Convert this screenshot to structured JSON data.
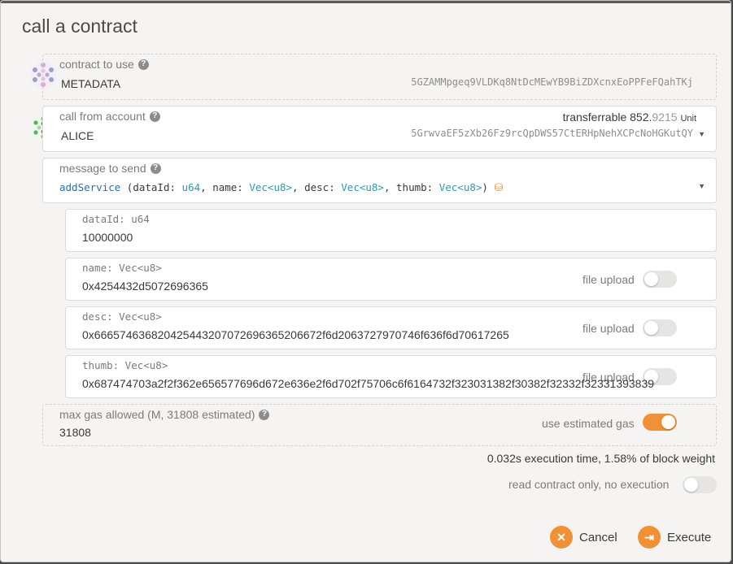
{
  "dialog": {
    "title": "call a contract"
  },
  "contract": {
    "label": "contract to use",
    "name": "METADATA",
    "address": "5GZAMMpgeq9VLDKq8NtDcMEwYB9BiZDXcnxEoPPFeFQahTKj"
  },
  "account": {
    "label": "call from account",
    "name": "ALICE",
    "address": "5GrwvaEF5zXb26Fz9rcQpDWS57CtERHpNehXCPcNoHGKutQY",
    "transferrable_label": "transferrable",
    "balance_int": "852.",
    "balance_dec": "9215",
    "unit": "Unit"
  },
  "message": {
    "label": "message to send",
    "name": "addService",
    "sig_open": " (",
    "params": [
      {
        "name": "dataId",
        "type": "u64"
      },
      {
        "name": "name",
        "type": "Vec<u8>"
      },
      {
        "name": "desc",
        "type": "Vec<u8>"
      },
      {
        "name": "thumb",
        "type": "Vec<u8>"
      }
    ],
    "sig_close": ")"
  },
  "args": [
    {
      "label": "dataId: u64",
      "value": "10000000",
      "has_upload": false
    },
    {
      "label": "name: Vec<u8>",
      "value": "0x4254432d5072696365",
      "has_upload": true,
      "upload_label": "file upload"
    },
    {
      "label": "desc: Vec<u8>",
      "value": "0x666574636820425443207072696365206672f6d2063727970746f636f6d70617265",
      "has_upload": true,
      "upload_label": "file upload"
    },
    {
      "label": "thumb: Vec<u8>",
      "value": "0x687474703a2f2f362e656577696d672e636e2f6d702f75706c6f6164732f323031382f30382f32332f32331393839",
      "has_upload": true,
      "upload_label": "file upload"
    }
  ],
  "gas": {
    "label": "max gas allowed (M, 31808 estimated)",
    "value": "31808",
    "estimated_label": "use estimated gas",
    "estimated_on": true
  },
  "execution_info": "0.032s execution time, 1.58% of block weight",
  "read_only": {
    "label": "read contract only, no execution",
    "on": false
  },
  "buttons": {
    "cancel": "Cancel",
    "execute": "Execute"
  },
  "colors": {
    "accent": "#f19135",
    "type_color": "#2e9bb0",
    "name_color": "#2a6fb0"
  },
  "icons": {
    "help": "question-circle-icon",
    "cancel": "close-icon",
    "execute": "sign-in-icon",
    "database": "database-icon"
  }
}
